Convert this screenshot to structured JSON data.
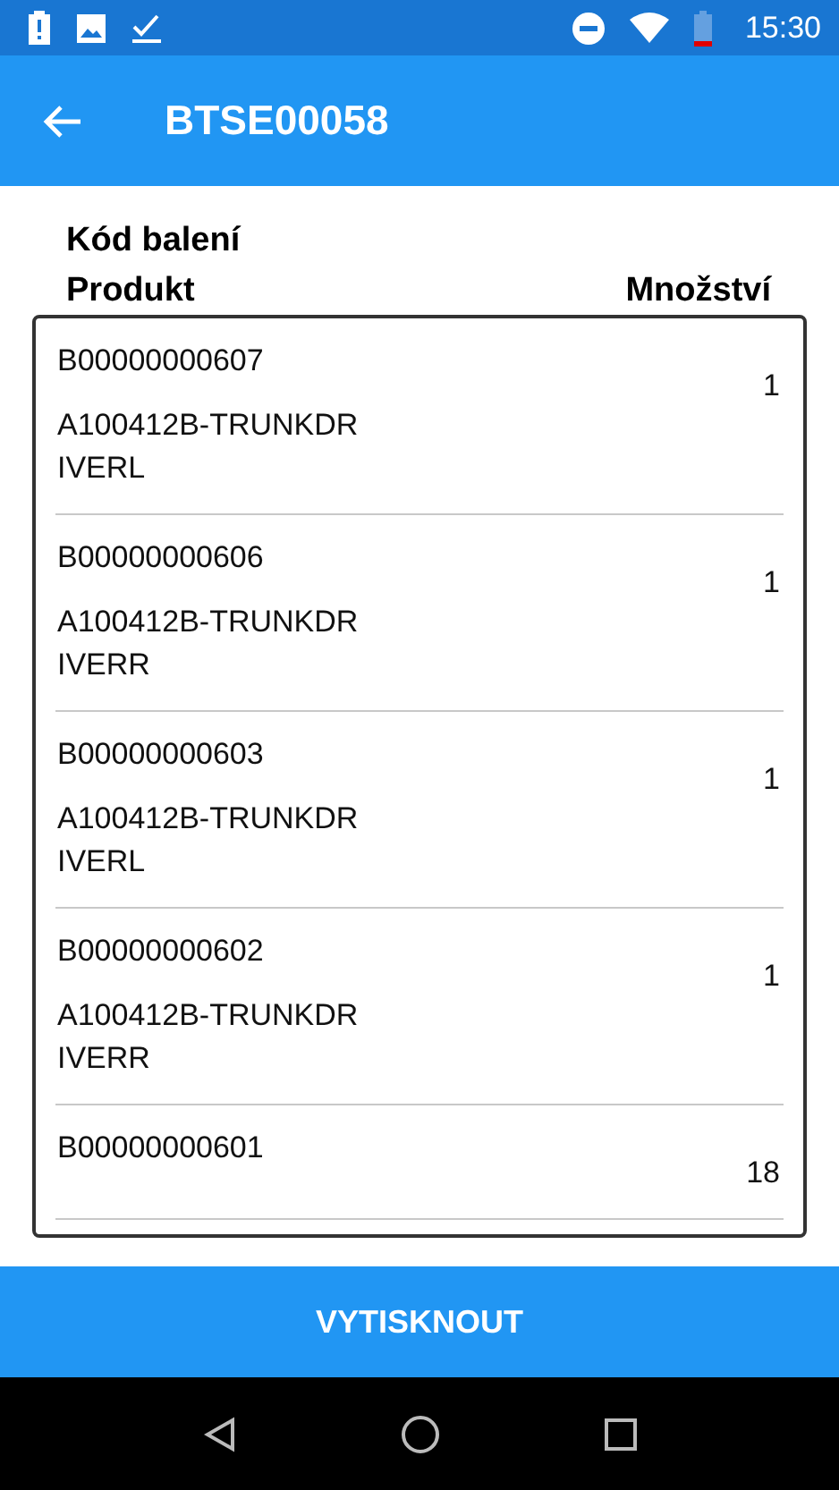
{
  "status_bar": {
    "time": "15:30"
  },
  "app_bar": {
    "title": "BTSE00058"
  },
  "header": {
    "label": "Kód balení",
    "columns": [
      "Produkt",
      "Množství"
    ]
  },
  "items": [
    {
      "code": "B00000000607",
      "product": "A100412B-TRUNKDR\nIVERL",
      "quantity": "1"
    },
    {
      "code": "B00000000606",
      "product": "A100412B-TRUNKDR\nIVERR",
      "quantity": "1"
    },
    {
      "code": "B00000000603",
      "product": "A100412B-TRUNKDR\nIVERL",
      "quantity": "1"
    },
    {
      "code": "B00000000602",
      "product": "A100412B-TRUNKDR\nIVERR",
      "quantity": "1"
    },
    {
      "code": "B00000000601",
      "quantity": "18"
    }
  ],
  "action_button": {
    "label": "VYTISKNOUT"
  }
}
